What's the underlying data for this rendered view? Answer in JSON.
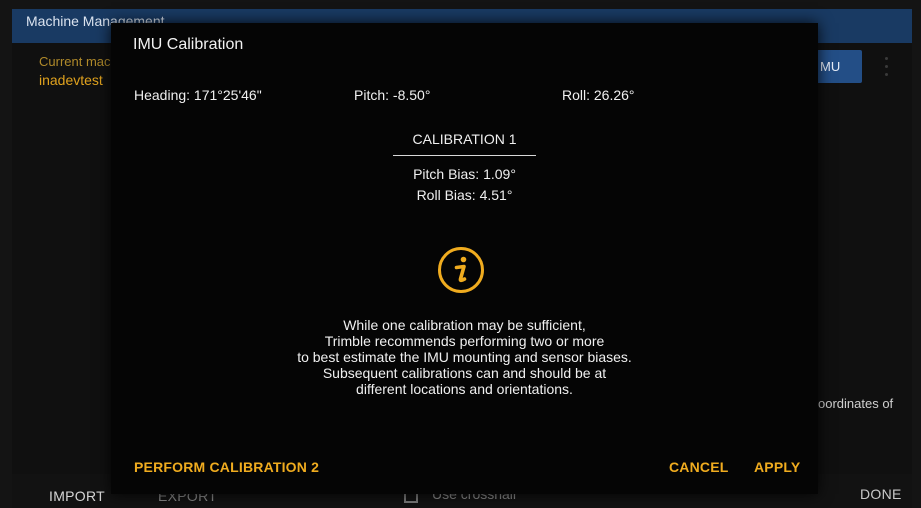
{
  "background": {
    "app_title": "Machine Management",
    "current_label": "Current mac",
    "current_value": "inadevtest",
    "imu_button_label": "MU",
    "coords_text": "oordinates of",
    "import_label": "IMPORT",
    "export_label": "EXPORT",
    "checkbox_label": "Use crosshair",
    "done_label": "DONE"
  },
  "dialog": {
    "title": "IMU Calibration",
    "readings": {
      "heading": "Heading: 171°25'46\"",
      "pitch": "Pitch: -8.50°",
      "roll": "Roll: 26.26°"
    },
    "calibration": {
      "title": "CALIBRATION 1",
      "pitch_bias": "Pitch Bias: 1.09°",
      "roll_bias": "Roll Bias: 4.51°"
    },
    "info_icon": "info-icon",
    "message_lines": [
      "While one calibration may be sufficient,",
      "Trimble recommends performing two or more",
      "to best estimate the IMU mounting and sensor biases.",
      "Subsequent calibrations can and should be at",
      "different locations and orientations."
    ],
    "actions": {
      "perform": "PERFORM CALIBRATION 2",
      "cancel": "CANCEL",
      "apply": "APPLY"
    }
  },
  "colors": {
    "accent": "#f0ac1f",
    "app_bar": "#193a63",
    "dialog_bg": "#050505"
  }
}
